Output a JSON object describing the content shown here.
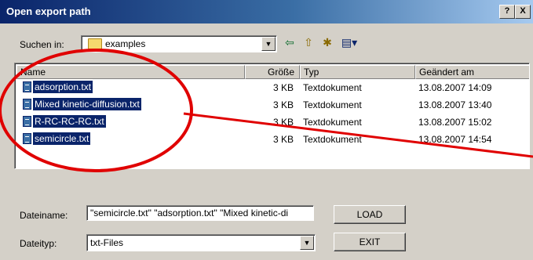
{
  "window": {
    "title": "Open export path",
    "help_label": "?",
    "close_label": "X"
  },
  "toolbar": {
    "lookin_label": "Suchen in:",
    "lookin_value": "examples",
    "dropdown_arrow": "▼",
    "back_icon": "⇦",
    "up_icon": "⇧",
    "newfolder_icon": "✱",
    "view_icon": "▤▾"
  },
  "list": {
    "columns": [
      "Name",
      "Größe",
      "Typ",
      "Geändert am"
    ],
    "files": [
      {
        "name": "adsorption.txt",
        "size": "3 KB",
        "type": "Textdokument",
        "date": "13.08.2007 14:09"
      },
      {
        "name": "Mixed kinetic-diffusion.txt",
        "size": "3 KB",
        "type": "Textdokument",
        "date": "13.08.2007 13:40"
      },
      {
        "name": "R-RC-RC-RC.txt",
        "size": "3 KB",
        "type": "Textdokument",
        "date": "13.08.2007 15:02"
      },
      {
        "name": "semicircle.txt",
        "size": "3 KB",
        "type": "Textdokument",
        "date": "13.08.2007 14:54"
      }
    ]
  },
  "form": {
    "filename_label": "Dateiname:",
    "filename_value": "\"semicircle.txt\" \"adsorption.txt\" \"Mixed kinetic-di",
    "filetype_label": "Dateityp:",
    "filetype_value": "txt-Files",
    "load_label": "LOAD",
    "exit_label": "EXIT"
  },
  "colors": {
    "selection": "#0a246a",
    "annotation": "#e00000"
  },
  "icons": {
    "folder": "folder-icon",
    "file": "text-file-icon"
  }
}
